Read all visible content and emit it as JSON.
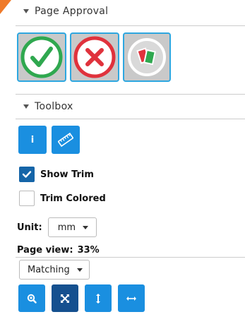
{
  "page_approval": {
    "header": "Page Approval",
    "approve_label": "",
    "reject_label": "",
    "reset_label": ""
  },
  "toolbox": {
    "header": "Toolbox",
    "info_label": "i",
    "show_trim": {
      "label": "Show Trim",
      "checked": true
    },
    "trim_colored": {
      "label": "Trim Colored",
      "checked": false
    },
    "unit": {
      "label": "Unit:",
      "value": "mm"
    },
    "page_view": {
      "label": "Page view:",
      "value": "33%"
    },
    "matching": {
      "value": "Matching"
    }
  },
  "colors": {
    "accent": "#1a8fe0",
    "dark_accent": "#15508f",
    "approve_green": "#2fa84f",
    "reject_red": "#e0323c",
    "flag_orange": "#ef7a2a"
  }
}
